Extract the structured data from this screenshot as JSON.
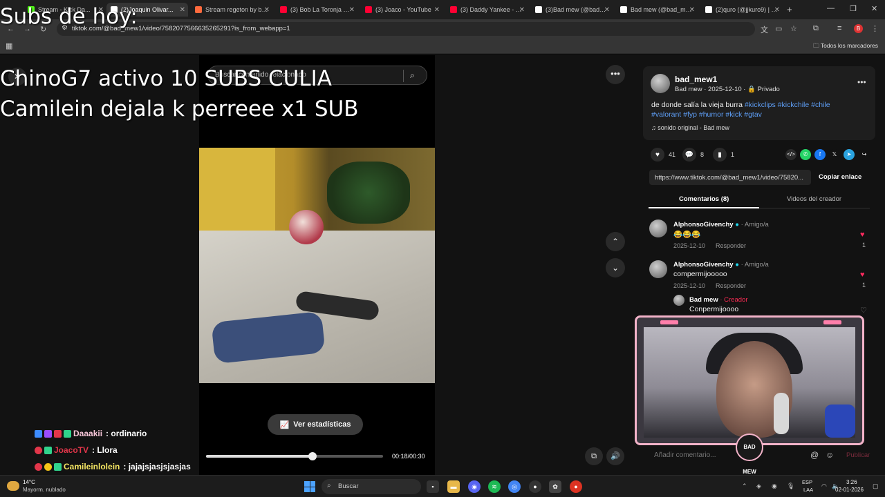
{
  "browser": {
    "tabs": [
      {
        "label": "Stream - Kick Da...",
        "color": "#53fc18"
      },
      {
        "label": "(2)Joaquin Olivar...",
        "color": "#ffffff"
      },
      {
        "label": "Stream regeton by be...",
        "color": "#ff6a3d"
      },
      {
        "label": "(3) Bob La Toronja Vs...",
        "color": "#ff0033"
      },
      {
        "label": "(3) Joaco - YouTube",
        "color": "#ff0033"
      },
      {
        "label": "(3) Daddy Yankee - L...",
        "color": "#ff0033"
      },
      {
        "label": "(3)Bad mew (@bad_m...",
        "color": "#ffffff"
      },
      {
        "label": "Bad mew (@bad_me...",
        "color": "#ffffff"
      },
      {
        "label": "(2)quro (@jjkuro9) | T...",
        "color": "#ffffff"
      }
    ],
    "url": "tiktok.com/@bad_mew1/video/7582077566635265291?is_from_webapp=1",
    "bookmarks_label": "Todos los marcadores",
    "profile_initial": "B"
  },
  "video": {
    "search_placeholder": "Buscar contenido relacionado",
    "stats_button": "Ver estadísticas",
    "time": "00:18/00:30",
    "progress": 0.6
  },
  "post": {
    "username": "bad_mew1",
    "meta": "Bad mew · 2025-12-10 ·",
    "privacy": "Privado",
    "description": "de donde salía la vieja burra",
    "hashtags_line1": "#kickclips #kickchile #chile",
    "hashtags_line2": "#valorant #fyp #humor #kick #gtav",
    "music": "sonido original - Bad mew",
    "likes": "41",
    "comments": "8",
    "saves": "1",
    "link": "https://www.tiktok.com/@bad_mew1/video/75820...",
    "copy_link": "Copiar enlace",
    "tab_comments": "Comentarios (8)",
    "tab_videos": "Videos del creador"
  },
  "comments": [
    {
      "name": "AlphonsoGivenchy",
      "rel": "· Amigo/a",
      "text": "😂😂😂",
      "date": "2025-12-10",
      "reply": "Responder",
      "likes": "1"
    },
    {
      "name": "AlphonsoGivenchy",
      "rel": "· Amigo/a",
      "text": "compermijooooo",
      "date": "2025-12-10",
      "reply": "Responder",
      "likes": "1"
    },
    {
      "name": "Bad mew",
      "rel": "· Creador",
      "text": "Conpermijoooo"
    }
  ],
  "comment_input_placeholder": "Añadir comentario...",
  "comment_post": "Publicar",
  "stream_overlay": {
    "title": "Subs de hoy:",
    "line1": "ChinoG7 activo 10 SUBS CULIA",
    "line2": "Camilein dejala k perreee x1 SUB",
    "chat": [
      {
        "user": "Daaakii",
        "user_color": "#f7c6d8",
        "msg": ": ordinario"
      },
      {
        "user": "JoacoTV",
        "user_color": "#e2364a",
        "msg": ": Llora"
      },
      {
        "user": "Camileinlolein",
        "user_color": "#f5e663",
        "msg": ": jajajsjasjsjasjas"
      }
    ]
  },
  "webcam_logo": "BAD MEW",
  "taskbar": {
    "temp": "14°C",
    "weather": "Mayorm. nublado",
    "search": "Buscar",
    "lang1": "ESP",
    "lang2": "LAA",
    "time": "3:26",
    "date": "02-01-2026"
  }
}
